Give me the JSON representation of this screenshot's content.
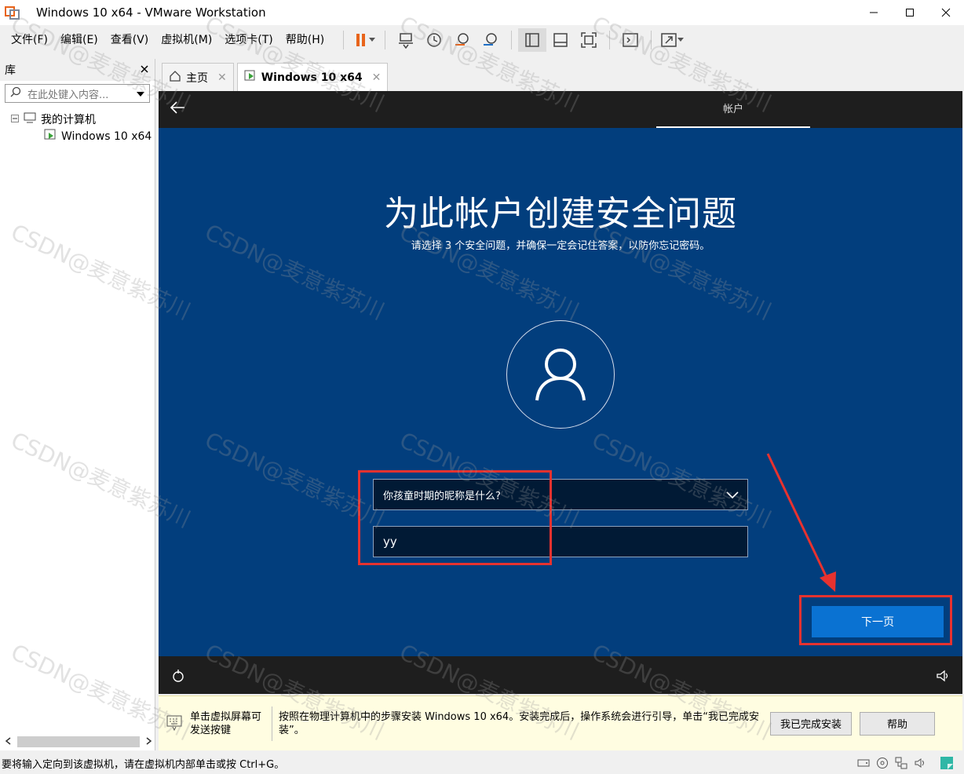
{
  "window": {
    "title": "Windows 10 x64 - VMware Workstation"
  },
  "menu": [
    "文件(F)",
    "编辑(E)",
    "查看(V)",
    "虚拟机(M)",
    "选项卡(T)",
    "帮助(H)"
  ],
  "library": {
    "title": "库",
    "search_placeholder": "在此处键入内容...",
    "tree_root": "我的计算机",
    "tree_child": "Windows 10 x64"
  },
  "tabs": [
    {
      "label": "主页"
    },
    {
      "label": "Windows 10 x64"
    }
  ],
  "vm": {
    "section_label": "帐户",
    "headline": "为此帐户创建安全问题",
    "subtitle": "请选择 3 个安全问题，并确保一定会记住答案，以防你忘记密码。",
    "question": "你孩童时期的昵称是什么?",
    "answer": "yy",
    "next_label": "下一页"
  },
  "hint": {
    "left": "单击虚拟屏幕可发送按键",
    "text": "按照在物理计算机中的步骤安装 Windows 10 x64。安装完成后，操作系统会进行引导，单击“我已完成安装”。",
    "done_label": "我已完成安装",
    "help_label": "帮助"
  },
  "status": {
    "text": "要将输入定向到该虚拟机，请在虚拟机内部单击或按 Ctrl+G。"
  },
  "watermark": "CSDN@麦意紫苏川",
  "colors": {
    "vm_background": "#023e7d",
    "next_button": "#0a72d2",
    "highlight": "#e7322f",
    "pause_icon": "#e8641b"
  }
}
